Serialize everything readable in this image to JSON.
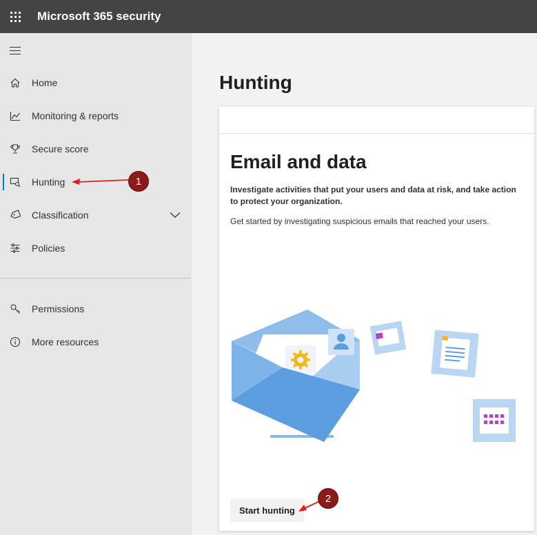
{
  "header": {
    "title": "Microsoft 365 security"
  },
  "sidebar": {
    "items": [
      {
        "label": "Home",
        "icon": "home-icon"
      },
      {
        "label": "Monitoring & reports",
        "icon": "chart-icon"
      },
      {
        "label": "Secure score",
        "icon": "trophy-icon"
      },
      {
        "label": "Hunting",
        "icon": "hunting-icon",
        "active": true
      },
      {
        "label": "Classification",
        "icon": "tag-icon",
        "expandable": true
      },
      {
        "label": "Policies",
        "icon": "sliders-icon"
      },
      {
        "label": "Permissions",
        "icon": "key-icon"
      },
      {
        "label": "More resources",
        "icon": "info-icon"
      }
    ]
  },
  "main": {
    "title": "Hunting",
    "card": {
      "heading": "Email and data",
      "description": "Investigate activities that put your users and data at risk, and take action to protect your organization.",
      "subtext": "Get started by investigating suspicious emails that reached your users.",
      "button_label": "Start hunting"
    }
  },
  "annotations": {
    "marker_1": "1",
    "marker_2": "2"
  },
  "colors": {
    "topbar": "#464442",
    "sidebar": "#e6e6e6",
    "accent": "#0078d4",
    "marker": "#8b1a1a",
    "arrow": "#e02020"
  }
}
